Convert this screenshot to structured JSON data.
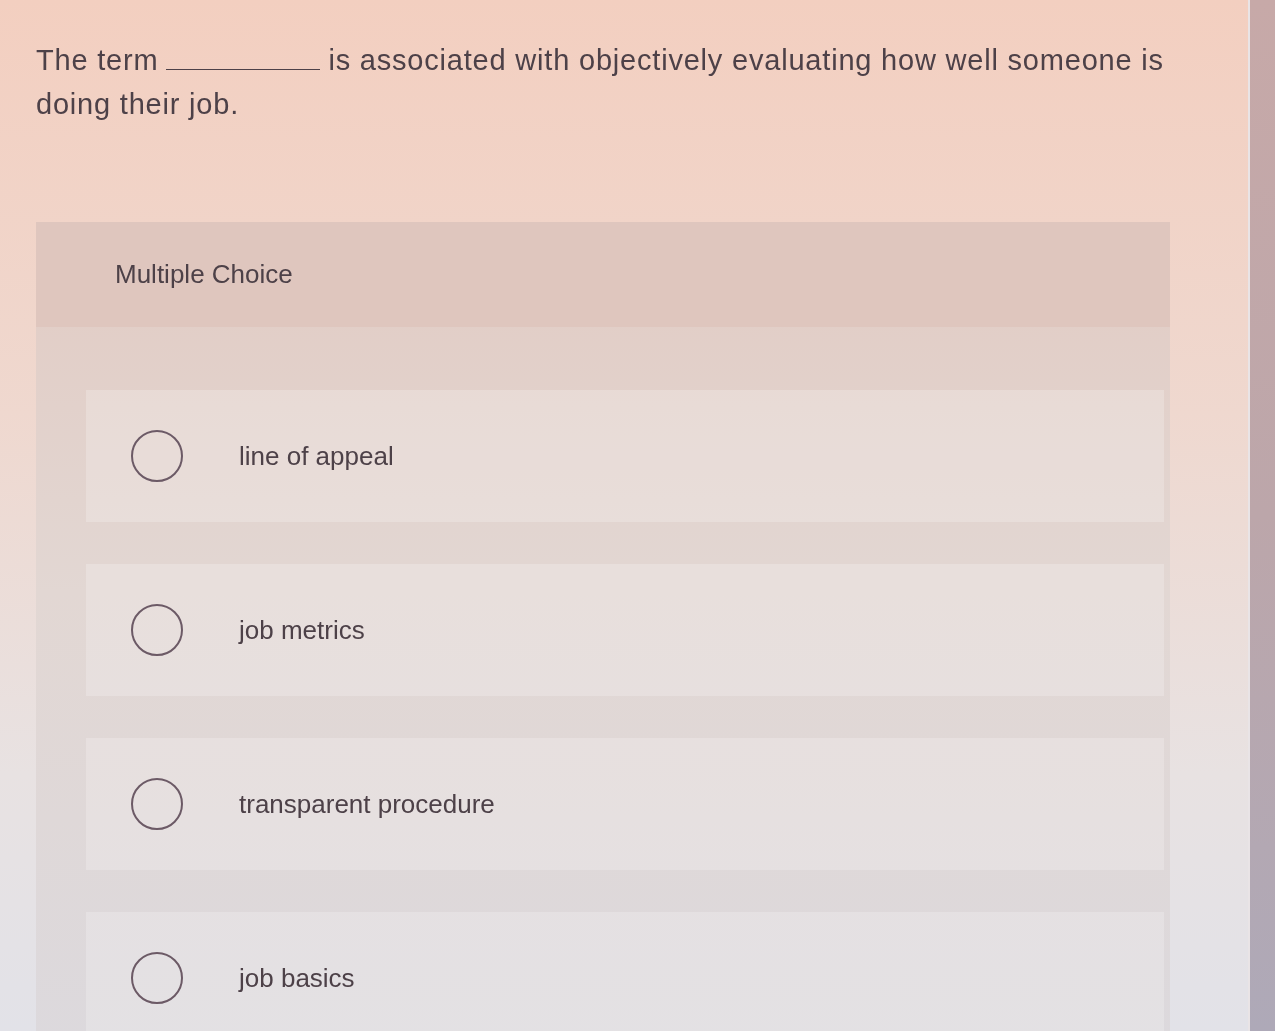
{
  "question": {
    "parts": [
      {
        "kind": "text",
        "text": "The term"
      },
      {
        "kind": "blank"
      },
      {
        "kind": "text",
        "text": "is associated with objectively evaluating how well someone is"
      },
      {
        "kind": "text",
        "text": "doing their job."
      }
    ]
  },
  "answer_card": {
    "heading": "Multiple Choice",
    "options": [
      {
        "label": "line of appeal",
        "selected": false
      },
      {
        "label": "job metrics",
        "selected": false
      },
      {
        "label": "transparent procedure",
        "selected": false
      },
      {
        "label": "job basics",
        "selected": false
      }
    ]
  }
}
